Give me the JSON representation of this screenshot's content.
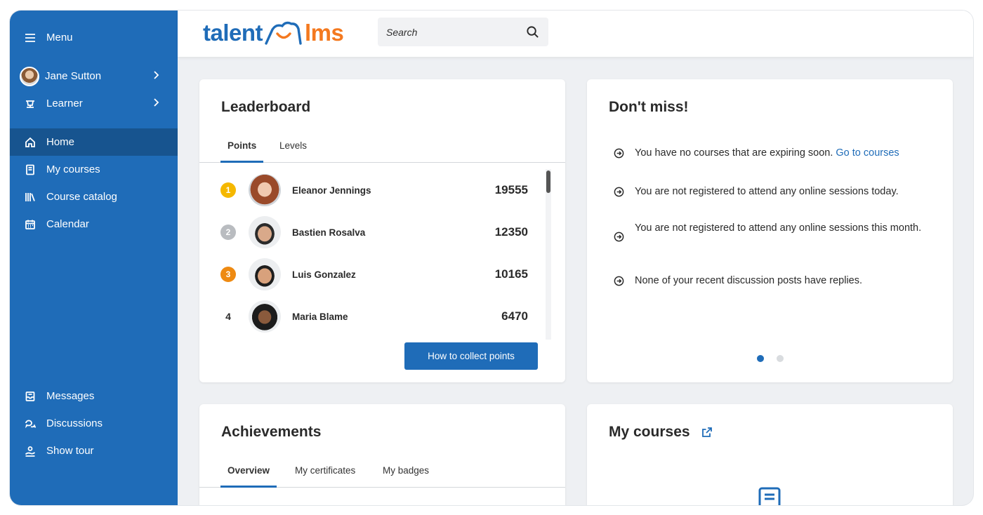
{
  "sidebar": {
    "menu_label": "Menu",
    "user_name": "Jane Sutton",
    "role": "Learner",
    "nav": [
      {
        "label": "Home",
        "icon": "home-icon",
        "active": true
      },
      {
        "label": "My courses",
        "icon": "book-icon",
        "active": false
      },
      {
        "label": "Course catalog",
        "icon": "library-icon",
        "active": false
      },
      {
        "label": "Calendar",
        "icon": "calendar-icon",
        "active": false
      }
    ],
    "bottom": [
      {
        "label": "Messages",
        "icon": "inbox-icon"
      },
      {
        "label": "Discussions",
        "icon": "chat-icon"
      },
      {
        "label": "Show tour",
        "icon": "tour-icon"
      }
    ]
  },
  "header": {
    "logo_left": "talent",
    "logo_right": "lms",
    "search_placeholder": "Search"
  },
  "leaderboard": {
    "title": "Leaderboard",
    "tabs": [
      "Points",
      "Levels"
    ],
    "active_tab": "Points",
    "rows": [
      {
        "rank": "1",
        "name": "Eleanor Jennings",
        "points": "19555",
        "medal": "gold"
      },
      {
        "rank": "2",
        "name": "Bastien Rosalva",
        "points": "12350",
        "medal": "silver"
      },
      {
        "rank": "3",
        "name": "Luis Gonzalez",
        "points": "10165",
        "medal": "bronze"
      },
      {
        "rank": "4",
        "name": "Maria Blame",
        "points": "6470",
        "medal": "none"
      }
    ],
    "button_label": "How to collect points"
  },
  "dont_miss": {
    "title": "Don't miss!",
    "items": [
      {
        "text": "You have no courses that are expiring soon.",
        "link": "Go to courses"
      },
      {
        "text": "You are not registered to attend any online sessions today."
      },
      {
        "text": "You are not registered to attend any online sessions this month."
      },
      {
        "text": "None of your recent discussion posts have replies."
      }
    ],
    "carousel_pages": 2,
    "carousel_active": 1
  },
  "achievements": {
    "title": "Achievements",
    "tabs": [
      "Overview",
      "My certificates",
      "My badges"
    ],
    "active_tab": "Overview"
  },
  "my_courses": {
    "title": "My courses"
  },
  "colors": {
    "brand_blue": "#1f6cb8",
    "brand_orange": "#f4791f",
    "gold": "#f5b800",
    "silver": "#b9bcc0",
    "bronze": "#ee8a12"
  }
}
